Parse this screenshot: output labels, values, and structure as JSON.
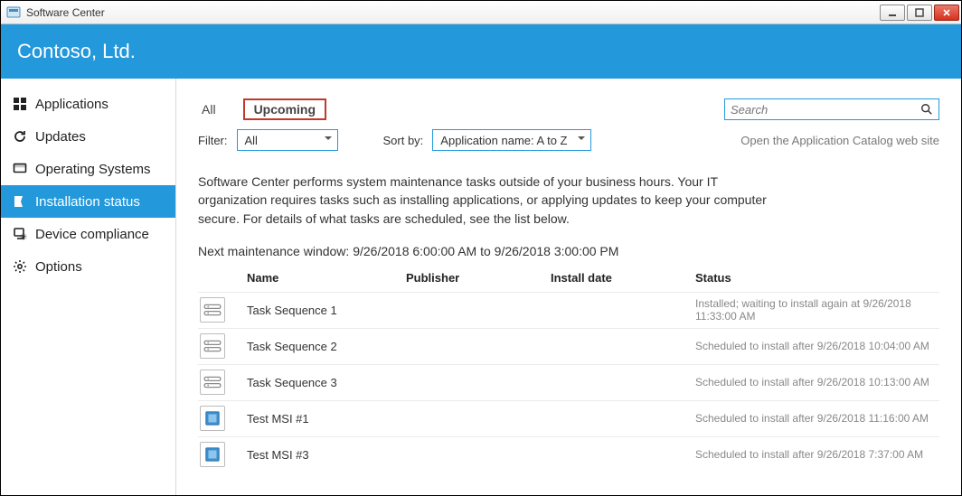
{
  "window": {
    "title": "Software Center"
  },
  "brand": {
    "company": "Contoso, Ltd."
  },
  "sidebar": {
    "items": [
      {
        "label": "Applications"
      },
      {
        "label": "Updates"
      },
      {
        "label": "Operating Systems"
      },
      {
        "label": "Installation status"
      },
      {
        "label": "Device compliance"
      },
      {
        "label": "Options"
      }
    ]
  },
  "tabs": {
    "all": "All",
    "upcoming": "Upcoming"
  },
  "search": {
    "placeholder": "Search"
  },
  "filters": {
    "filter_label": "Filter:",
    "filter_value": "All",
    "sort_label": "Sort by:",
    "sort_value": "Application name: A to Z"
  },
  "catalog_link": "Open the Application Catalog web site",
  "description": "Software Center performs system maintenance tasks outside of your business hours. Your IT organization requires tasks such as installing applications, or applying updates to keep your computer secure. For details of what tasks are scheduled, see the list below.",
  "maintenance_window": "Next maintenance window: 9/26/2018 6:00:00 AM to 9/26/2018 3:00:00 PM",
  "columns": {
    "name": "Name",
    "publisher": "Publisher",
    "install_date": "Install date",
    "status": "Status"
  },
  "items": [
    {
      "icon": "ts",
      "name": "Task Sequence 1",
      "publisher": "",
      "install_date": "",
      "status": "Installed; waiting to install again at 9/26/2018 11:33:00 AM"
    },
    {
      "icon": "ts",
      "name": "Task Sequence 2",
      "publisher": "",
      "install_date": "",
      "status": "Scheduled to install after 9/26/2018 10:04:00 AM"
    },
    {
      "icon": "ts",
      "name": "Task Sequence 3",
      "publisher": "",
      "install_date": "",
      "status": "Scheduled to install after 9/26/2018 10:13:00 AM"
    },
    {
      "icon": "msi",
      "name": "Test MSI #1",
      "publisher": "",
      "install_date": "",
      "status": "Scheduled to install after 9/26/2018 11:16:00 AM"
    },
    {
      "icon": "msi",
      "name": "Test MSI #3",
      "publisher": "",
      "install_date": "",
      "status": "Scheduled to install after 9/26/2018 7:37:00 AM"
    }
  ]
}
